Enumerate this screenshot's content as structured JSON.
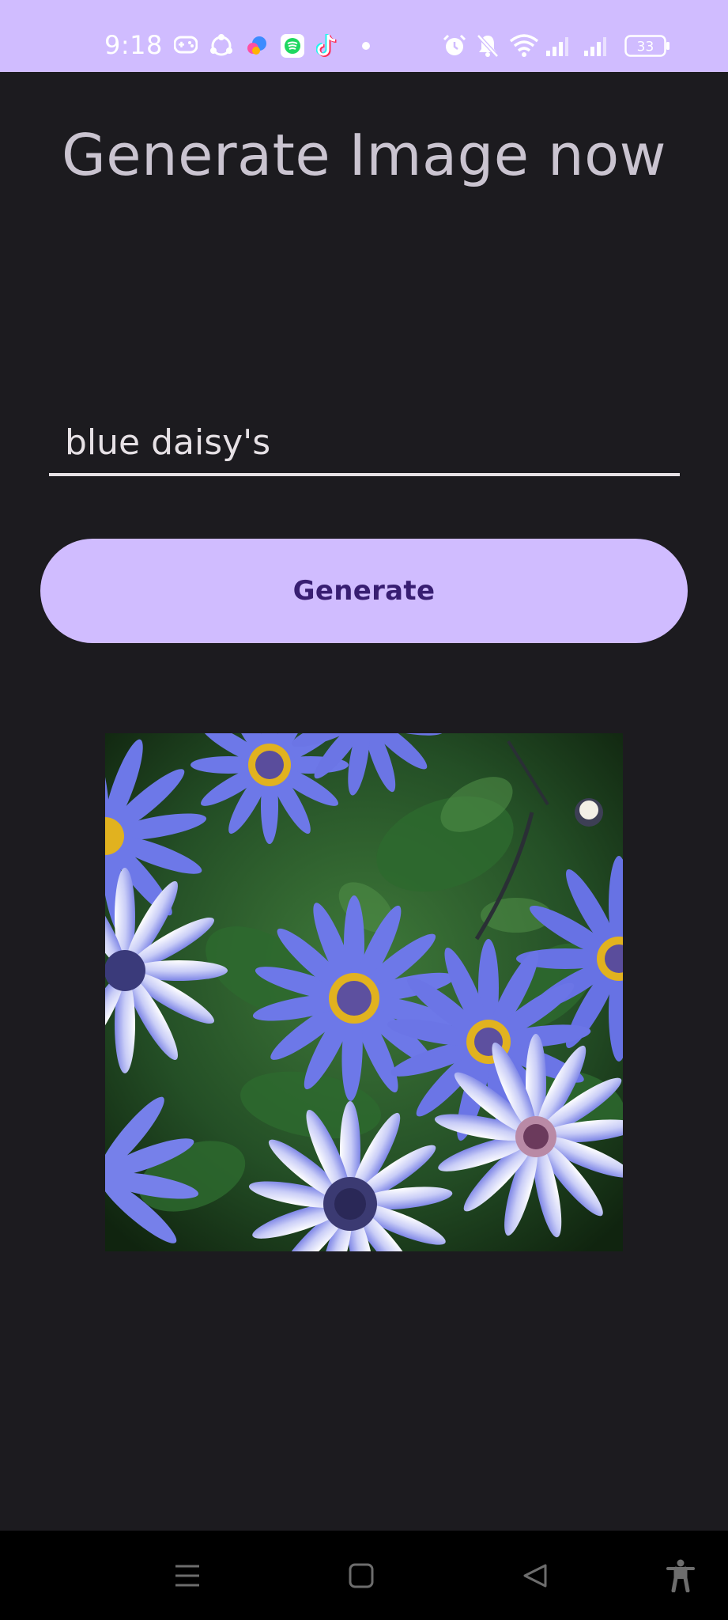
{
  "status_bar": {
    "time": "9:18",
    "battery_level": "33",
    "icons": [
      "game-controller-icon",
      "app-hub-icon",
      "colorful-app-icon",
      "messaging-app-icon",
      "tiktok-icon",
      "notification-dot-icon",
      "alarm-icon",
      "silent-bell-icon",
      "wifi-icon",
      "signal-icon",
      "signal-icon-2",
      "battery-icon"
    ],
    "background": "#d0bcff"
  },
  "header": {
    "title": "Generate Image now"
  },
  "prompt": {
    "value": "blue daisy's"
  },
  "actions": {
    "generate_label": "Generate"
  },
  "result": {
    "image_subject": "blue-daisy-flowers-image"
  },
  "nav_bar": {
    "icons": [
      "menu-icon",
      "home-icon",
      "back-icon",
      "accessibility-icon"
    ]
  },
  "colors": {
    "accent": "#d0bcff",
    "background": "#1c1b1f",
    "on_accent": "#381e72",
    "title": "#cac4d0",
    "text": "#e6e1e5"
  }
}
